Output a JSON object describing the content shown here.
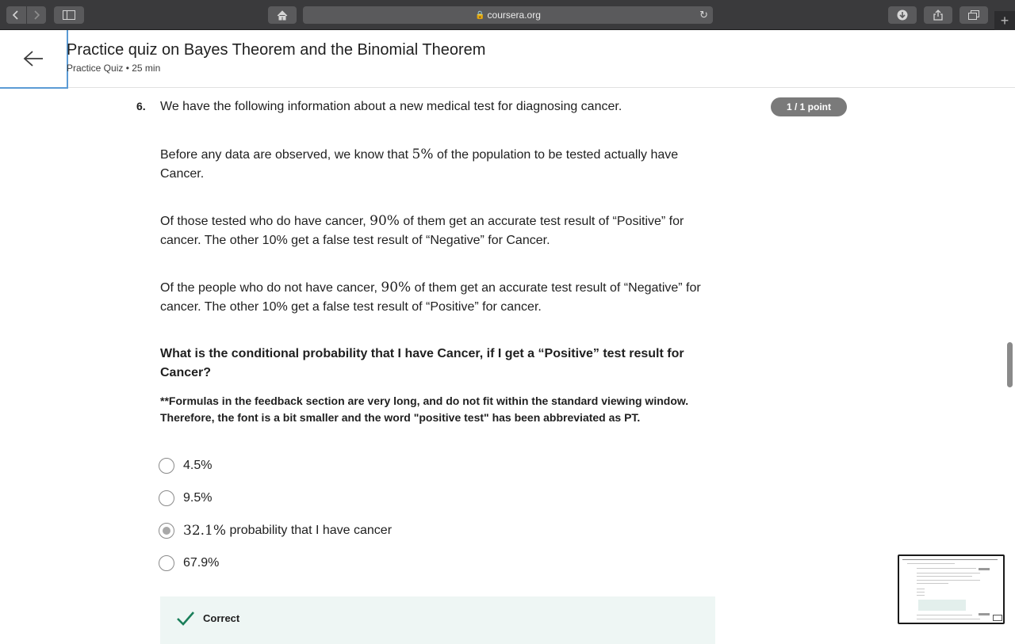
{
  "browser": {
    "url": "coursera.org",
    "new_tab_glyph": "+"
  },
  "header": {
    "title": "Practice quiz on Bayes Theorem and the Binomial Theorem",
    "subtitle": "Practice Quiz • 25 min"
  },
  "question": {
    "number": "6.",
    "points": "1 / 1 point",
    "intro": "We have the following information about a new medical test for diagnosing cancer.",
    "p1_a": "Before any data are observed, we know that ",
    "p1_math": "5%",
    "p1_b": " of the population to be tested actually have Cancer.",
    "p2_a": "Of those tested who do have cancer, ",
    "p2_math": "90%",
    "p2_b": " of them get an accurate test result of “Positive” for cancer. The other 10% get a false test result of “Negative” for Cancer.",
    "p3_a": "Of the people who do not have cancer, ",
    "p3_math": "90%",
    "p3_b": " of them get an accurate test result of “Negative” for cancer. The other 10% get a false test result of “Positive” for cancer.",
    "ask": "What is the conditional probability that I have Cancer, if I get a “Positive” test result for Cancer?",
    "note": "**Formulas in the feedback section are very long, and do not fit within the standard viewing window. Therefore, the font is a bit smaller and the word \"positive test\" has been abbreviated as PT.",
    "options": [
      {
        "label": "4.5%"
      },
      {
        "label": "9.5%"
      },
      {
        "math": "32.1%",
        "label": " probability that I have cancer",
        "selected": true
      },
      {
        "label": "67.9%"
      }
    ]
  },
  "feedback": {
    "status": "Correct"
  },
  "colors": {
    "accent_border": "#5b9bd5",
    "points_badge": "#7a7a7a",
    "feedback_bg": "#eef6f4",
    "correct_green": "#1a7f5a"
  }
}
